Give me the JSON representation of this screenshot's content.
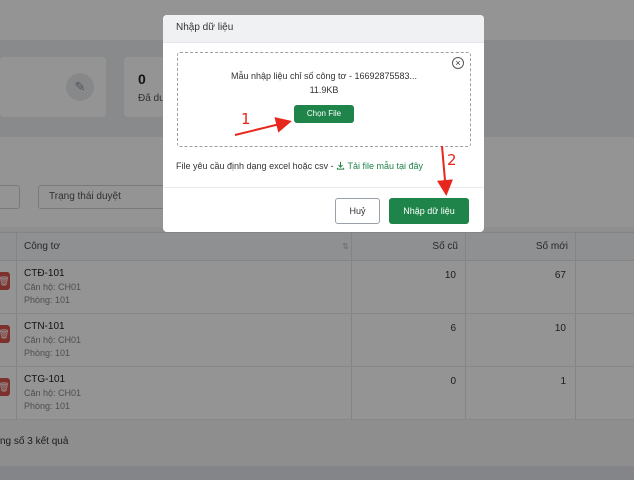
{
  "stats": [
    {
      "value": "",
      "label": ""
    },
    {
      "value": "0",
      "label": "Đã dư"
    }
  ],
  "filters": {
    "status_placeholder": "Trạng thái duyệt"
  },
  "table": {
    "headers": {
      "name": "Công tơ",
      "old": "Số cũ",
      "new": "Số mới"
    },
    "rows": [
      {
        "code": "CTĐ-101",
        "apartment": "Căn hộ: CH01",
        "room": "Phòng: 101",
        "old": "10",
        "new": "67"
      },
      {
        "code": "CTN-101",
        "apartment": "Căn hộ: CH01",
        "room": "Phòng: 101",
        "old": "6",
        "new": "10"
      },
      {
        "code": "CTG-101",
        "apartment": "Căn hộ: CH01",
        "room": "Phòng: 101",
        "old": "0",
        "new": "1"
      }
    ],
    "total_text": "ng số 3 kết quả"
  },
  "modal": {
    "title": "Nhập dữ liệu",
    "file_name": "Mẫu nhập liệu chỉ số công tơ - 16692875583...",
    "file_size": "11.9KB",
    "choose_file_label": "Chọn File",
    "hint_text": "File yêu cầu định dạng excel hoặc csv -",
    "hint_link": "Tải file mẫu tại đây",
    "cancel_label": "Huỷ",
    "import_label": "Nhập dữ liệu"
  },
  "annotations": {
    "step1": "1",
    "step2": "2",
    "color": "#e8271c"
  },
  "colors": {
    "primary": "#1e8449",
    "danger": "#d9534f"
  },
  "icons": {
    "stat": "edit-icon",
    "close": "close-circle-icon",
    "download": "download-icon",
    "delete": "trash-icon"
  }
}
